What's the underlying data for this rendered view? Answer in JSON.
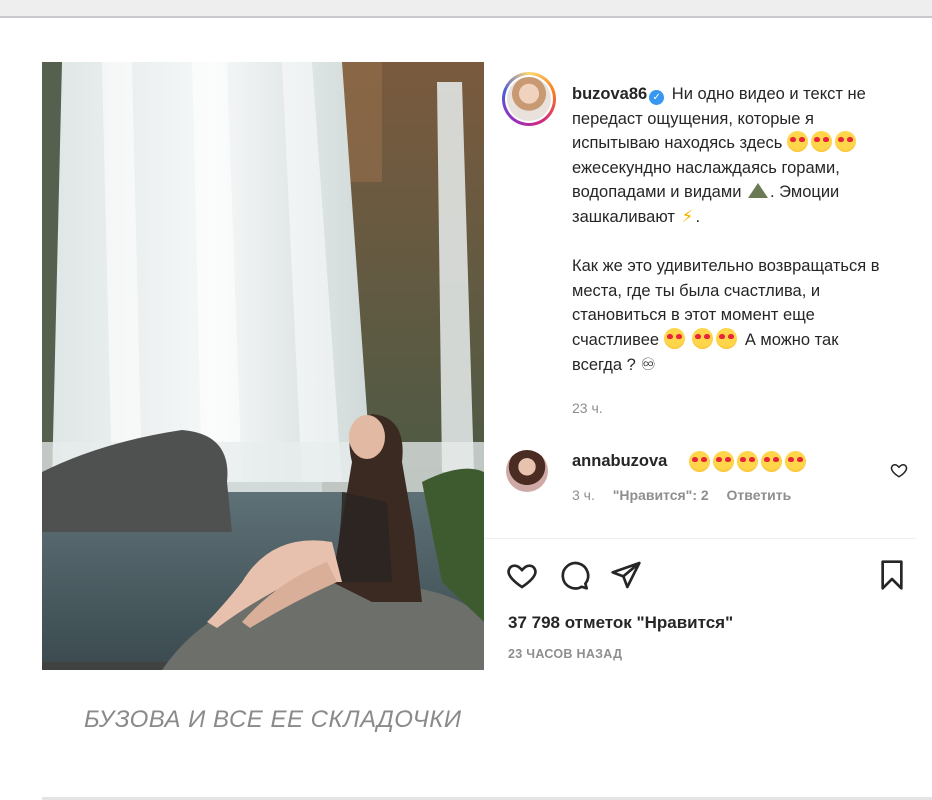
{
  "post": {
    "username": "buzova86",
    "caption_part1": "Ни одно видео и текст не передаст ощущения, которые я испытываю находясь здесь",
    "caption_part2": "ежесекундно наслаждаясь горами, водопадами и видами",
    "caption_part3": ". Эмоции зашкаливают",
    "caption_part4": ".",
    "caption_part5": "Как же это удивительно возвращаться в места, где ты была счастлива, и становиться в этот момент еще счастливее",
    "caption_part6": "А можно так всегда ?",
    "infinity": "♾",
    "time": "23 ч.",
    "likes": "37 798 отметок \"Нравится\"",
    "posted_ago": "23 ЧАСОВ НАЗАД"
  },
  "comment": {
    "username": "annabuzova",
    "time": "3 ч.",
    "likes_label": "\"Нравится\": 2",
    "reply_label": "Ответить"
  },
  "article": {
    "headline": "БУЗОВА И ВСЕ ЕЕ СКЛАДОЧКИ"
  },
  "icons": {
    "like": "heart-icon",
    "comment": "comment-bubble-icon",
    "share": "paper-plane-icon",
    "save": "bookmark-icon"
  },
  "colors": {
    "verified": "#3897f0",
    "meta_text": "#8e8e8e",
    "headline": "#8a8a8a"
  }
}
